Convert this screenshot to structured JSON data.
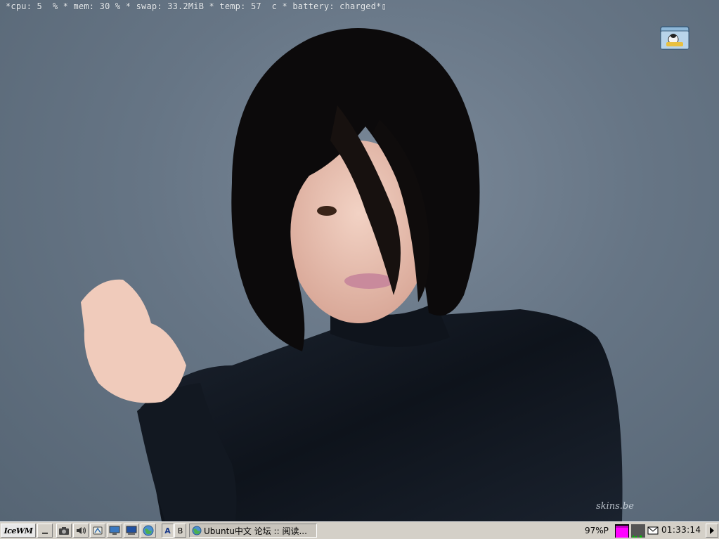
{
  "desktop": {
    "conky_text": "*cpu: 5  % * mem: 30 % * swap: 33.2MiB * temp: 57  c * battery: charged*▯",
    "watermark": "skins.be",
    "icon": "home-folder-icon"
  },
  "taskbar": {
    "start_label": "IceWM",
    "show_desktop_icon": "show-desktop-icon",
    "quick_launch": [
      {
        "name": "camera-icon"
      },
      {
        "name": "volume-icon"
      },
      {
        "name": "network-icon"
      },
      {
        "name": "display-icon"
      },
      {
        "name": "terminal-icon"
      },
      {
        "name": "browser-icon"
      }
    ],
    "workspaces": [
      "A",
      "B"
    ],
    "active_workspace": "A",
    "tasks": [
      {
        "label": "Ubuntu中文 论坛 :: 阅读..."
      }
    ],
    "battery": "97%P",
    "clock": "01:33:14"
  },
  "colors": {
    "taskbar_bg": "#d4d0c8",
    "cpu_graph": "#ff00ff",
    "net_graph": "#00c000",
    "desktop_bg": "#667585"
  }
}
